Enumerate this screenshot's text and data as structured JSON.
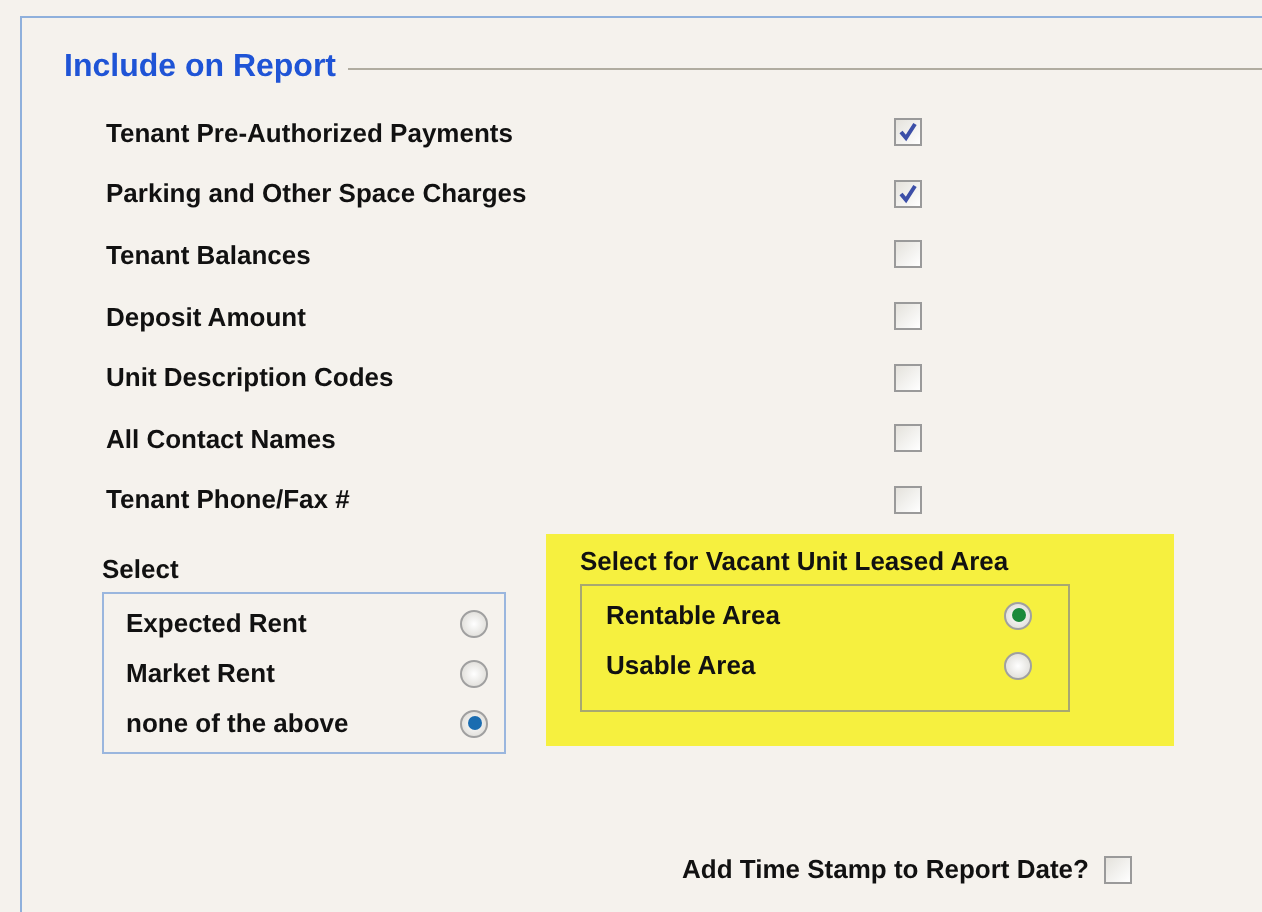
{
  "group": {
    "title": "Include on Report"
  },
  "options": [
    {
      "label": "Tenant Pre-Authorized Payments",
      "checked": true
    },
    {
      "label": "Parking and Other Space Charges",
      "checked": true
    },
    {
      "label": "Tenant Balances",
      "checked": false
    },
    {
      "label": "Deposit Amount",
      "checked": false
    },
    {
      "label": "Unit Description Codes",
      "checked": false
    },
    {
      "label": "All Contact Names",
      "checked": false
    },
    {
      "label": "Tenant Phone/Fax #",
      "checked": false
    }
  ],
  "select": {
    "title": "Select",
    "items": [
      {
        "label": "Expected Rent",
        "selected": false
      },
      {
        "label": "Market Rent",
        "selected": false
      },
      {
        "label": "none of the above",
        "selected": true
      }
    ]
  },
  "vacant": {
    "title": "Select for Vacant Unit Leased Area",
    "items": [
      {
        "label": "Rentable Area",
        "selected": true
      },
      {
        "label": "Usable Area",
        "selected": false
      }
    ]
  },
  "timestamp": {
    "label": "Add Time Stamp to Report Date?",
    "checked": false
  }
}
